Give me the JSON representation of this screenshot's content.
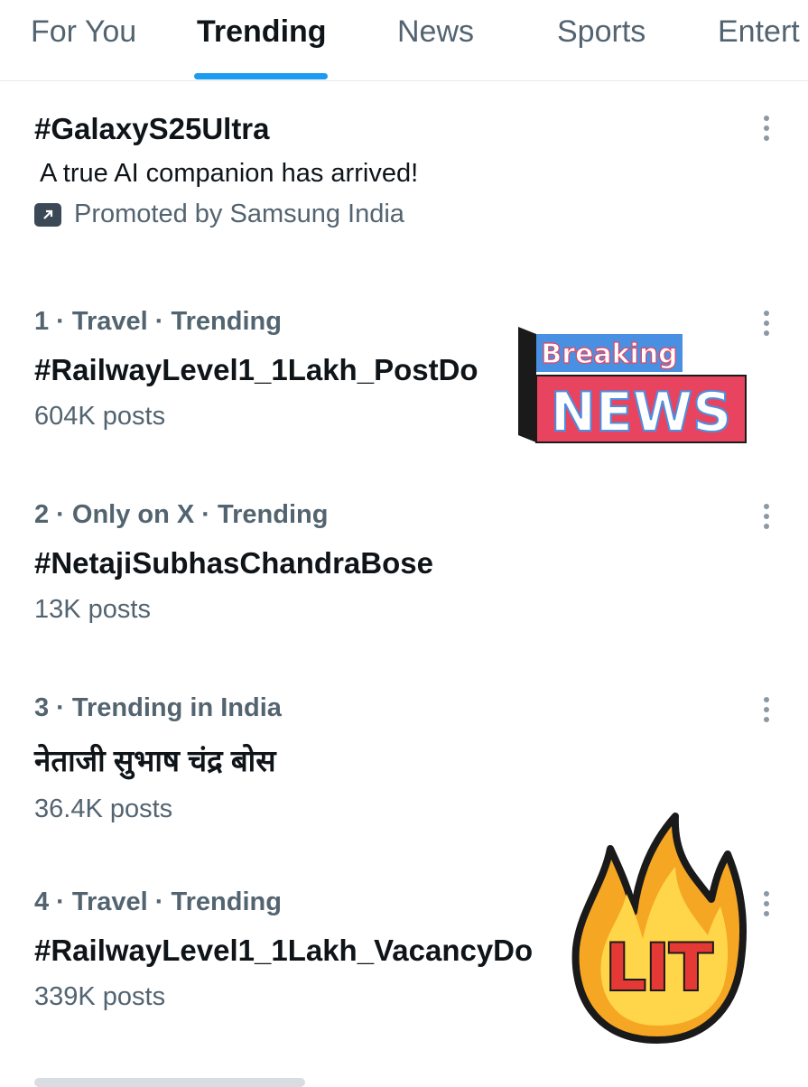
{
  "tabs": [
    {
      "label": "For You",
      "active": false
    },
    {
      "label": "Trending",
      "active": true
    },
    {
      "label": "News",
      "active": false
    },
    {
      "label": "Sports",
      "active": false
    },
    {
      "label": "Entert",
      "active": false
    }
  ],
  "promoted": {
    "title": "#GalaxyS25Ultra",
    "description": "A true AI companion has arrived!",
    "promoted_by": "Promoted by Samsung India"
  },
  "trends": [
    {
      "meta": "1 · Travel · Trending",
      "title": "#RailwayLevel1_1Lakh_PostDo",
      "posts": "604K posts"
    },
    {
      "meta": "2 · Only on X · Trending",
      "title": "#NetajiSubhasChandraBose",
      "posts": "13K posts"
    },
    {
      "meta": "3 · Trending in India",
      "title": "नेताजी सुभाष चंद्र बोस",
      "posts": "36.4K posts"
    },
    {
      "meta": "4 · Travel · Trending",
      "title": "#RailwayLevel1_1Lakh_VacancyDo",
      "posts": "339K posts"
    }
  ],
  "stickers": {
    "breaking_news": {
      "top": "Breaking",
      "bottom": "NEWS"
    },
    "lit": {
      "text": "LIT"
    }
  },
  "colors": {
    "accent": "#1d9bf0",
    "secondary_text": "#536471",
    "primary_text": "#0f1419",
    "breaking_blue": "#4a90e2",
    "news_red": "#e8445f",
    "flame_orange": "#f5a623"
  },
  "icons": {
    "more": "more-vertical-icon",
    "promoted": "promoted-arrow-icon"
  }
}
